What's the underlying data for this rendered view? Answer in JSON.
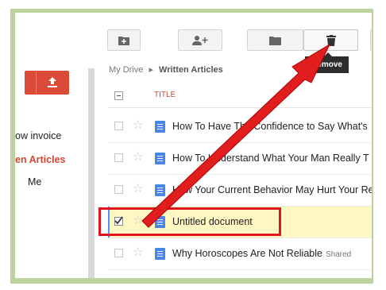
{
  "toolbar": {
    "buttons": [
      {
        "icon": "new-folder-icon"
      },
      {
        "icon": "share-icon"
      },
      {
        "icon": "move-folder-icon"
      },
      {
        "icon": "trash-icon"
      }
    ],
    "tooltip": "Remove"
  },
  "sidebar": {
    "items": [
      {
        "label": "ow invoice"
      },
      {
        "label": "en Articles"
      },
      {
        "label": "Me"
      }
    ]
  },
  "breadcrumb": {
    "root": "My Drive",
    "separator": "▸",
    "current": "Written Articles"
  },
  "table": {
    "header": "TITLE"
  },
  "files": [
    {
      "title": "How To Have The Confidence to Say What's",
      "shared": "",
      "selected": false
    },
    {
      "title": "How To Understand What Your Man Really T",
      "shared": "",
      "selected": false
    },
    {
      "title": "How Your Current Behavior May Hurt Your Re",
      "shared": "",
      "selected": false
    },
    {
      "title": "Untitled document",
      "shared": "",
      "selected": true
    },
    {
      "title": "Why Horoscopes Are Not Reliable",
      "shared": "Shared",
      "selected": false
    }
  ],
  "colors": {
    "accent": "#d14836",
    "highlight": "#e0141e",
    "doc": "#4a86e8"
  }
}
